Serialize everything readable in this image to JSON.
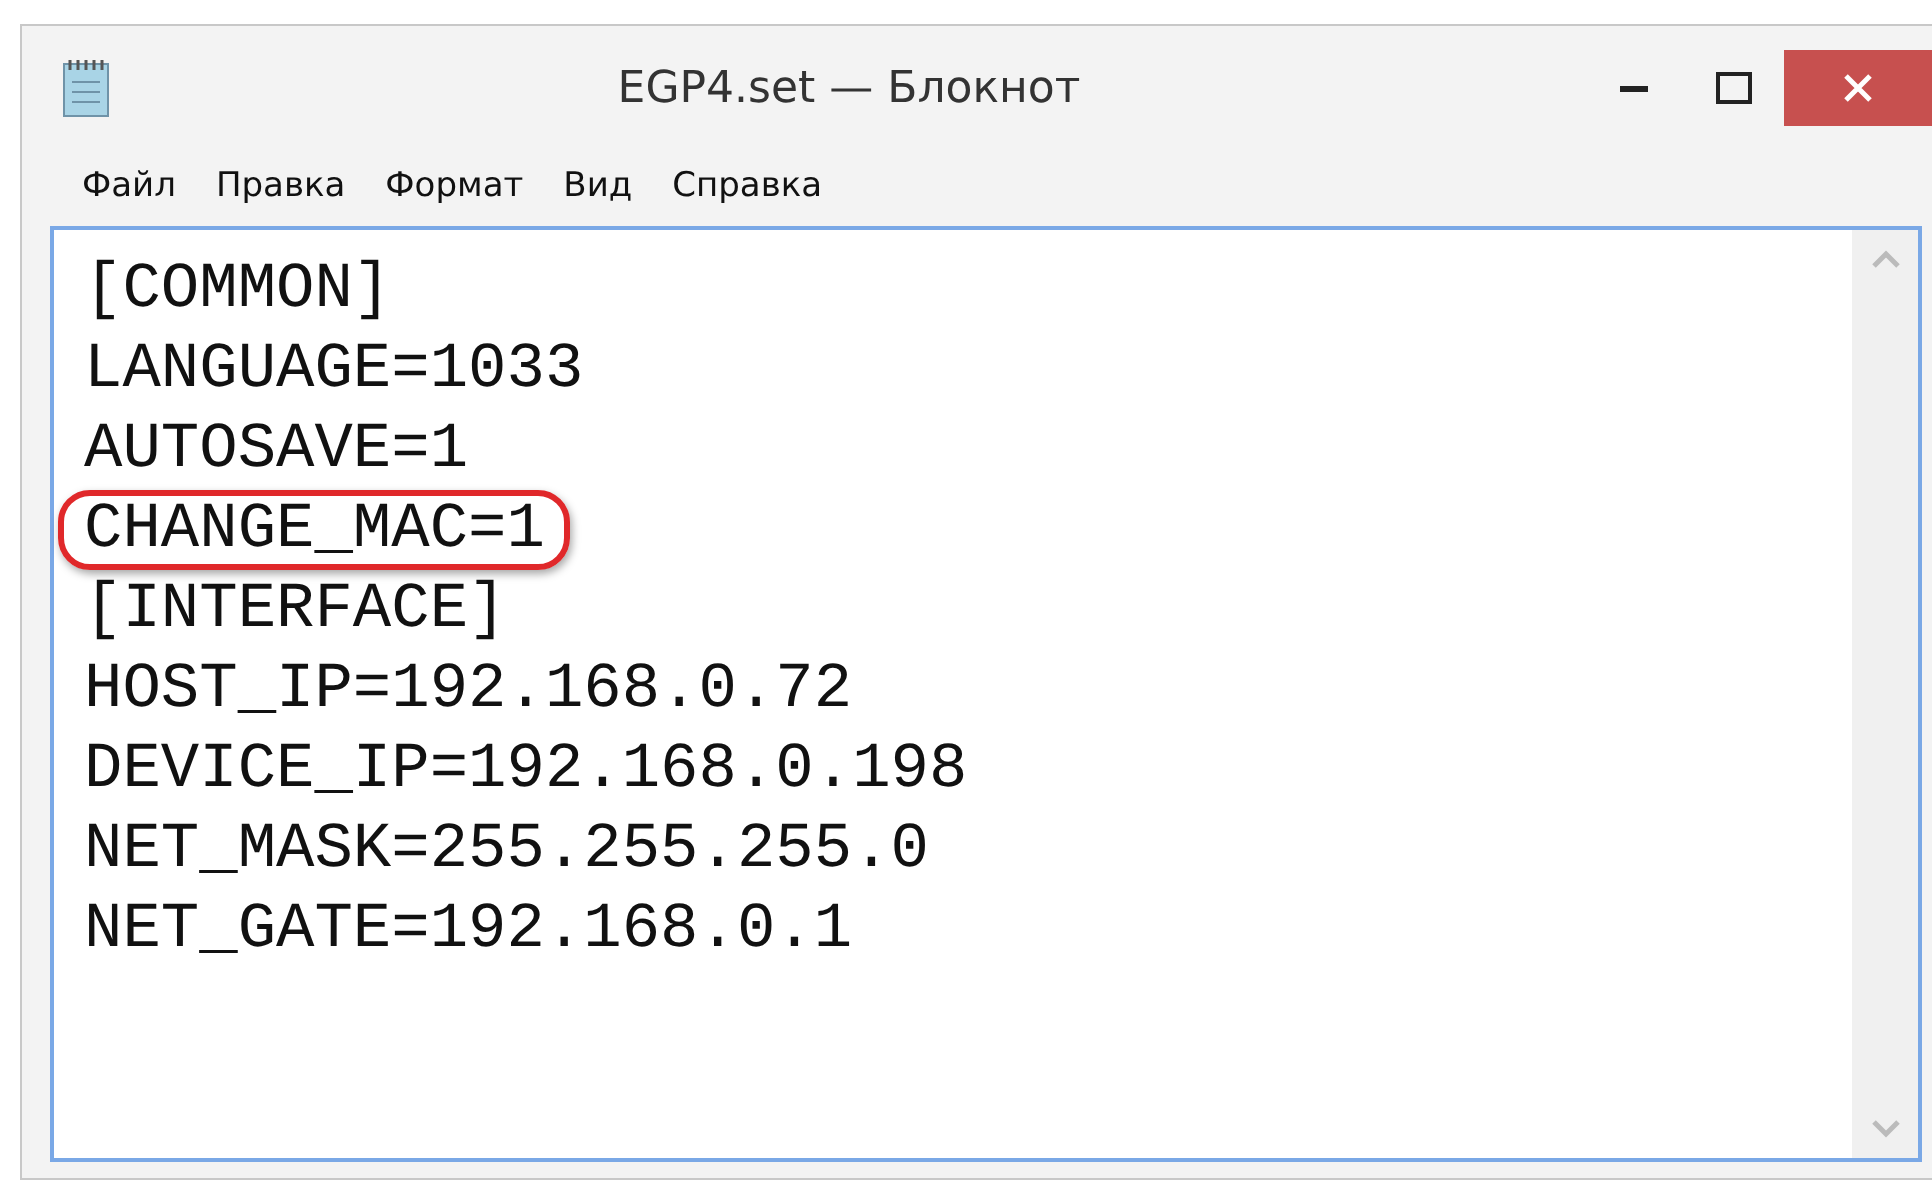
{
  "window": {
    "title": "EGP4.set — Блокнот"
  },
  "menu": [
    {
      "label": "Файл"
    },
    {
      "label": "Правка"
    },
    {
      "label": "Формат"
    },
    {
      "label": "Вид"
    },
    {
      "label": "Справка"
    }
  ],
  "lines": [
    {
      "text": "[COMMON]",
      "highlighted": false
    },
    {
      "text": "LANGUAGE=1033",
      "highlighted": false
    },
    {
      "text": "AUTOSAVE=1",
      "highlighted": false
    },
    {
      "text": "CHANGE_MAC=1",
      "highlighted": true
    },
    {
      "text": "[INTERFACE]",
      "highlighted": false
    },
    {
      "text": "HOST_IP=192.168.0.72",
      "highlighted": false
    },
    {
      "text": "DEVICE_IP=192.168.0.198",
      "highlighted": false
    },
    {
      "text": "NET_MASK=255.255.255.0",
      "highlighted": false
    },
    {
      "text": "NET_GATE=192.168.0.1",
      "highlighted": false
    }
  ]
}
